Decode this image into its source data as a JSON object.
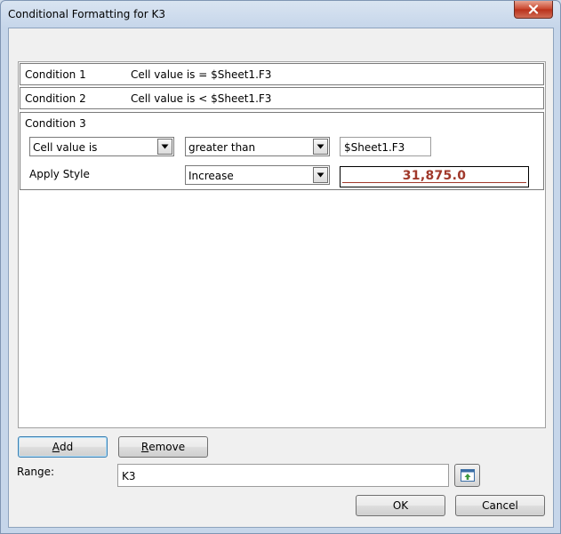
{
  "window": {
    "title": "Conditional Formatting for K3"
  },
  "conditions": [
    {
      "label": "Condition 1",
      "description": "Cell value is = $Sheet1.F3"
    },
    {
      "label": "Condition 2",
      "description": "Cell value is < $Sheet1.F3"
    }
  ],
  "condition3": {
    "label": "Condition 3",
    "type_value": "Cell value is",
    "operator_value": "greater than",
    "operand_value": "$Sheet1.F3",
    "apply_style_label": "Apply Style",
    "style_value": "Increase",
    "preview_text": "31,875.0"
  },
  "buttons": {
    "add_label_prefix": "",
    "add_label_underlined": "A",
    "add_label_rest": "dd",
    "remove_label_underlined": "R",
    "remove_label_rest": "emove",
    "ok_label": "OK",
    "cancel_label": "Cancel"
  },
  "range": {
    "label": "Range:",
    "value": "K3"
  },
  "colors": {
    "preview_text": "#a0382a",
    "close_button": "#c8432a"
  },
  "icons": {
    "close": "close-icon",
    "dropdown": "chevron-down-icon",
    "shrink": "shrink-range-icon"
  }
}
